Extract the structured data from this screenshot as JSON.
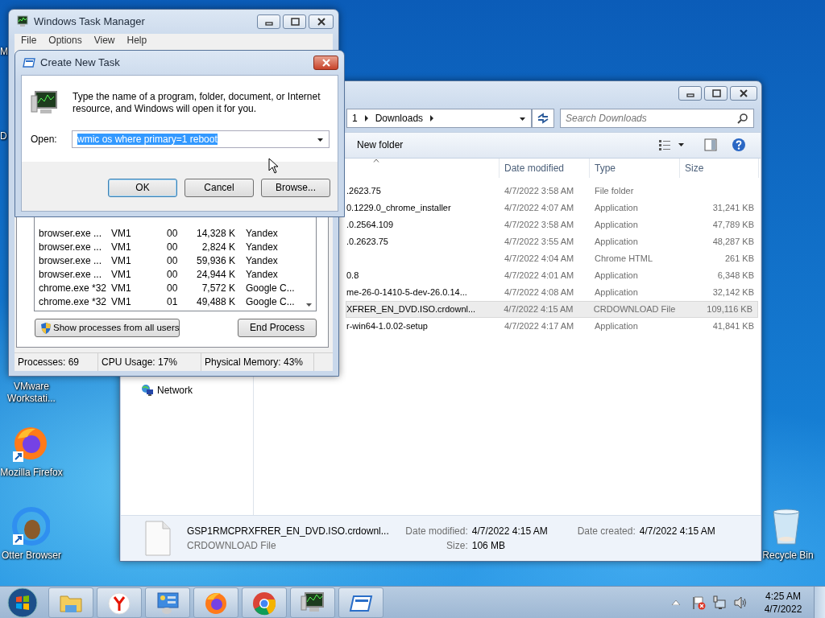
{
  "desktop": {
    "icons": [
      {
        "kind": "partial",
        "label": "M"
      },
      {
        "kind": "partial",
        "label": "D"
      },
      {
        "kind": "hidden",
        "label": "VMware Workstati..."
      },
      {
        "kind": "firefox",
        "label": "Mozilla Firefox"
      },
      {
        "kind": "otter",
        "label": "Otter Browser"
      },
      {
        "kind": "recycle",
        "label": "Recycle Bin"
      }
    ]
  },
  "explorer": {
    "address": [
      "1",
      "Downloads"
    ],
    "search": {
      "placeholder": "Search Downloads"
    },
    "toolbar": {
      "new_folder": "New folder"
    },
    "columns": [
      "Date modified",
      "Type",
      "Size"
    ],
    "rows": [
      {
        "name": ".2623.75",
        "date": "4/7/2022 3:58 AM",
        "type": "File folder",
        "selected": false
      },
      {
        "name": "0.1229.0_chrome_installer",
        "date": "4/7/2022 4:07 AM",
        "type": "Application",
        "size": "31,241 KB",
        "selected": false
      },
      {
        "name": ".0.2564.109",
        "date": "4/7/2022 3:58 AM",
        "type": "Application",
        "size": "47,789 KB",
        "selected": false
      },
      {
        "name": ".0.2623.75",
        "date": "4/7/2022 3:55 AM",
        "type": "Application",
        "size": "48,287 KB",
        "selected": false
      },
      {
        "date": "4/7/2022 4:04 AM",
        "type": "Chrome HTML",
        "size": "261 KB",
        "selected": false
      },
      {
        "name": "0.8",
        "date": "4/7/2022 4:01 AM",
        "type": "Application",
        "size": "6,348 KB",
        "selected": false
      },
      {
        "name": "me-26-0-1410-5-dev-26.0.14...",
        "date": "4/7/2022 4:08 AM",
        "type": "Application",
        "size": "32,142 KB",
        "selected": false
      },
      {
        "name": "XFRER_EN_DVD.ISO.crdownl...",
        "date": "4/7/2022 4:15 AM",
        "type": "CRDOWNLOAD File",
        "size": "109,116 KB",
        "selected": true
      },
      {
        "name": "r-win64-1.0.02-setup",
        "date": "4/7/2022 4:17 AM",
        "type": "Application",
        "size": "41,841 KB",
        "selected": false
      }
    ],
    "nav": [
      {
        "label": "Network"
      }
    ],
    "details": {
      "name": "GSP1RMCPRXFRER_EN_DVD.ISO.crdownl...",
      "type": "CRDOWNLOAD File",
      "fields": [
        {
          "label": "Date modified:",
          "value": "4/7/2022 4:15 AM"
        },
        {
          "label": "Size:",
          "value": "106 MB"
        },
        {
          "label": "Date created:",
          "value": "4/7/2022 4:15 AM"
        }
      ]
    }
  },
  "task_manager": {
    "title": "Windows Task Manager",
    "menu": [
      "File",
      "Options",
      "View",
      "Help"
    ],
    "processes": [
      {
        "name": "browser.exe ...",
        "user": "VM1",
        "cpu": "00",
        "memory": "14,328 K",
        "description": "Yandex",
        "selected": false
      },
      {
        "name": "browser.exe ...",
        "user": "VM1",
        "cpu": "00",
        "memory": "2,824 K",
        "description": "Yandex",
        "selected": false
      },
      {
        "name": "browser.exe ...",
        "user": "VM1",
        "cpu": "00",
        "memory": "59,936 K",
        "description": "Yandex",
        "selected": false
      },
      {
        "name": "browser.exe ...",
        "user": "VM1",
        "cpu": "00",
        "memory": "24,944 K",
        "description": "Yandex",
        "selected": false
      },
      {
        "name": "chrome.exe *32",
        "user": "VM1",
        "cpu": "00",
        "memory": "7,572 K",
        "description": "Google C...",
        "selected": false
      },
      {
        "name": "chrome.exe *32",
        "user": "VM1",
        "cpu": "01",
        "memory": "49,488 K",
        "description": "Google C...",
        "selected": false
      }
    ],
    "buttons": {
      "show_all": "Show processes from all users",
      "end": "End Process"
    },
    "status": [
      "Processes: 69",
      "CPU Usage: 17%",
      "Physical Memory: 43%"
    ]
  },
  "dialog": {
    "title": "Create New Task",
    "message": "Type the name of a program, folder, document, or Internet resource, and Windows will open it for you.",
    "open_label": "Open:",
    "value": "wmic os where primary=1 reboot",
    "text_selected": true,
    "buttons": [
      {
        "label": "OK",
        "default": true
      },
      {
        "label": "Cancel",
        "default": false
      },
      {
        "label": "Browse...",
        "default": false
      }
    ]
  },
  "taskbar": {
    "buttons": [
      {
        "kind": "explorer"
      },
      {
        "kind": "yandex"
      },
      {
        "kind": "control"
      },
      {
        "kind": "firefox"
      },
      {
        "kind": "chrome"
      },
      {
        "kind": "taskmgr"
      },
      {
        "kind": "window"
      }
    ],
    "clock": {
      "time": "4:25 AM",
      "date": "4/7/2022"
    }
  }
}
